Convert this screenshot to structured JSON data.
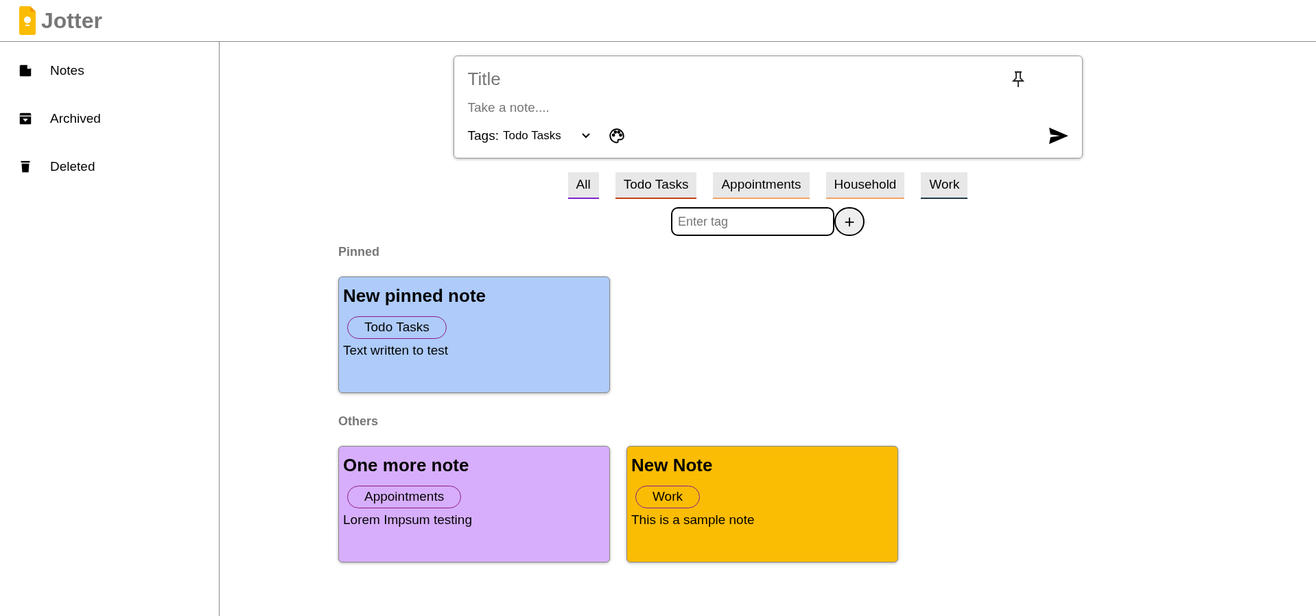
{
  "app": {
    "name": "Jotter"
  },
  "sidebar": {
    "items": [
      {
        "label": "Notes",
        "kind": "note"
      },
      {
        "label": "Archived",
        "kind": "archive"
      },
      {
        "label": "Deleted",
        "kind": "trash"
      }
    ]
  },
  "composer": {
    "title_placeholder": "Title",
    "body_placeholder": "Take a note....",
    "tags_label": "Tags:",
    "tag_value": "Todo Tasks"
  },
  "tag_filters": [
    {
      "label": "All",
      "color": "#7e22ce"
    },
    {
      "label": "Todo Tasks",
      "color": "#c2410c"
    },
    {
      "label": "Appointments",
      "color": "#f4a261"
    },
    {
      "label": "Household",
      "color": "#f4a261"
    },
    {
      "label": "Work",
      "color": "#1e3a4c"
    }
  ],
  "new_tag": {
    "placeholder": "Enter tag",
    "button": "+"
  },
  "sections": [
    {
      "heading": "Pinned",
      "notes": [
        {
          "title": "New pinned note",
          "tag": "Todo Tasks",
          "body": "Text written to test",
          "color": "#aecbfa"
        }
      ]
    },
    {
      "heading": "Others",
      "notes": [
        {
          "title": "One more note",
          "tag": "Appointments",
          "body": "Lorem Impsum testing",
          "color": "#d7aefb"
        },
        {
          "title": "New Note",
          "tag": "Work",
          "body": "This is a sample note",
          "color": "#fbbc04"
        }
      ]
    }
  ]
}
